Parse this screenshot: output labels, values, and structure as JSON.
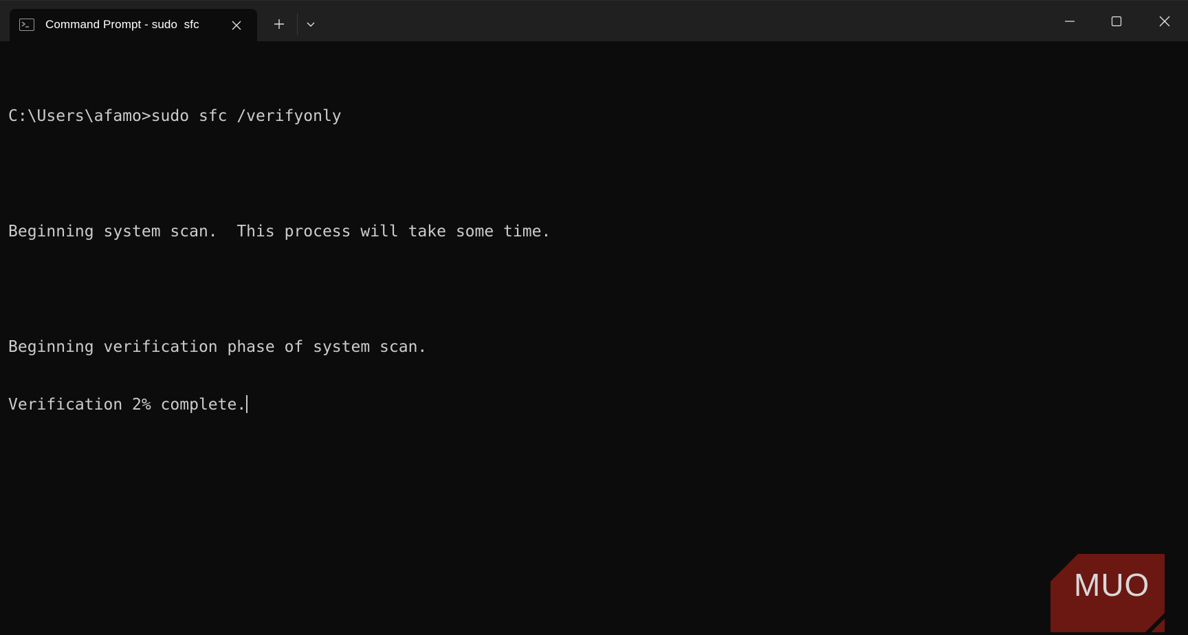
{
  "tab": {
    "title": "Command Prompt - sudo  sfc"
  },
  "terminal": {
    "lines": [
      "C:\\Users\\afamo>sudo sfc /verifyonly",
      "",
      "Beginning system scan.  This process will take some time.",
      "",
      "Beginning verification phase of system scan.",
      "Verification 2% complete."
    ]
  },
  "watermark": {
    "text": "MUO"
  },
  "icons": {
    "tab": "terminal-icon",
    "tab_close": "close-icon",
    "new_tab": "plus-icon",
    "dropdown": "chevron-down-icon",
    "minimize": "minimize-icon",
    "maximize": "maximize-icon",
    "close": "close-icon"
  },
  "colors": {
    "background": "#0c0c0c",
    "titlebar": "#202020",
    "text": "#cccccc",
    "watermark": "#7a1a15"
  }
}
